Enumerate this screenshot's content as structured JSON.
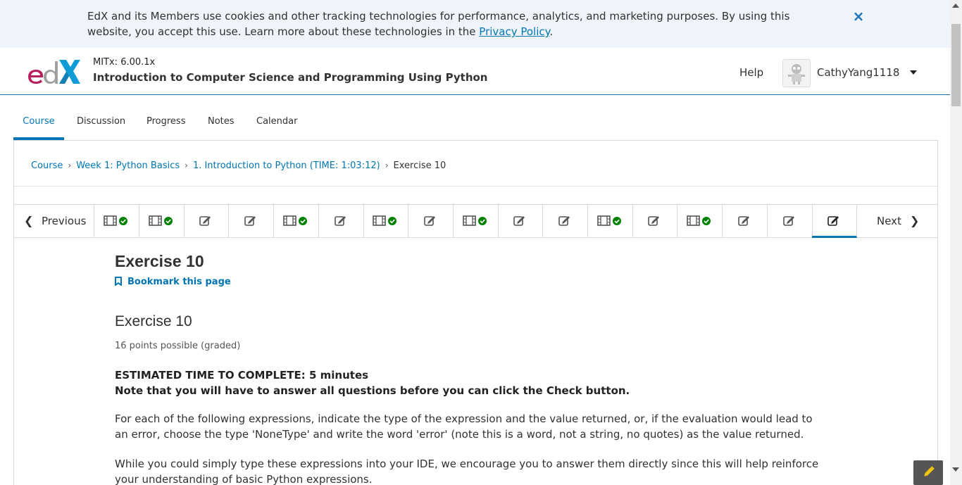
{
  "cookie_banner": {
    "text_before_link": "EdX and its Members use cookies and other tracking technologies for performance, analytics, and marketing purposes. By using this website, you accept this use. Learn more about these technologies in the ",
    "link_text": "Privacy Policy",
    "text_after_link": ".",
    "close_glyph": "×"
  },
  "header": {
    "course_org": "MITx: 6.00.1x",
    "course_title": "Introduction to Computer Science and Programming Using Python",
    "help_label": "Help",
    "username": "CathyYang1118"
  },
  "tabs": [
    {
      "label": "Course",
      "active": true
    },
    {
      "label": "Discussion",
      "active": false
    },
    {
      "label": "Progress",
      "active": false
    },
    {
      "label": "Notes",
      "active": false
    },
    {
      "label": "Calendar",
      "active": false
    }
  ],
  "breadcrumbs": {
    "items": [
      "Course",
      "Week 1: Python Basics",
      "1. Introduction to Python (TIME: 1:03:12)"
    ],
    "current": "Exercise 10",
    "separator": "›"
  },
  "sequence_nav": {
    "previous_label": "Previous",
    "next_label": "Next",
    "items": [
      {
        "type": "video",
        "completed": true
      },
      {
        "type": "video",
        "completed": true
      },
      {
        "type": "problem",
        "completed": false
      },
      {
        "type": "problem",
        "completed": false
      },
      {
        "type": "video",
        "completed": true
      },
      {
        "type": "problem",
        "completed": false
      },
      {
        "type": "video",
        "completed": true
      },
      {
        "type": "problem",
        "completed": false
      },
      {
        "type": "video",
        "completed": true
      },
      {
        "type": "problem",
        "completed": false
      },
      {
        "type": "problem",
        "completed": false
      },
      {
        "type": "video",
        "completed": true
      },
      {
        "type": "problem",
        "completed": false
      },
      {
        "type": "video",
        "completed": true
      },
      {
        "type": "problem",
        "completed": false
      },
      {
        "type": "problem",
        "completed": false
      },
      {
        "type": "problem",
        "completed": false,
        "active": true
      }
    ]
  },
  "unit": {
    "title": "Exercise 10",
    "bookmark_label": "Bookmark this page"
  },
  "problem": {
    "title": "Exercise 10",
    "points": "16 points possible (graded)",
    "estimated_time": "ESTIMATED TIME TO COMPLETE: 5 minutes",
    "note": "Note that you will have to answer all questions before you can click the Check button.",
    "paragraph1": "For each of the following expressions, indicate the type of the expression and the value returned, or, if the evaluation would lead to an error, choose the type 'NoneType' and write the word 'error' (note this is a word, not a string, no quotes) as the value returned.",
    "paragraph2": "While you could simply type these expressions into your IDE, we encourage you to answer them directly since this will help reinforce your understanding of basic Python expressions."
  },
  "colors": {
    "accent": "#0075b4",
    "banner_bg": "#eef4f9",
    "check_green": "#008100",
    "logo_magenta": "#b7205e",
    "logo_blue": "#0f9bd5"
  }
}
